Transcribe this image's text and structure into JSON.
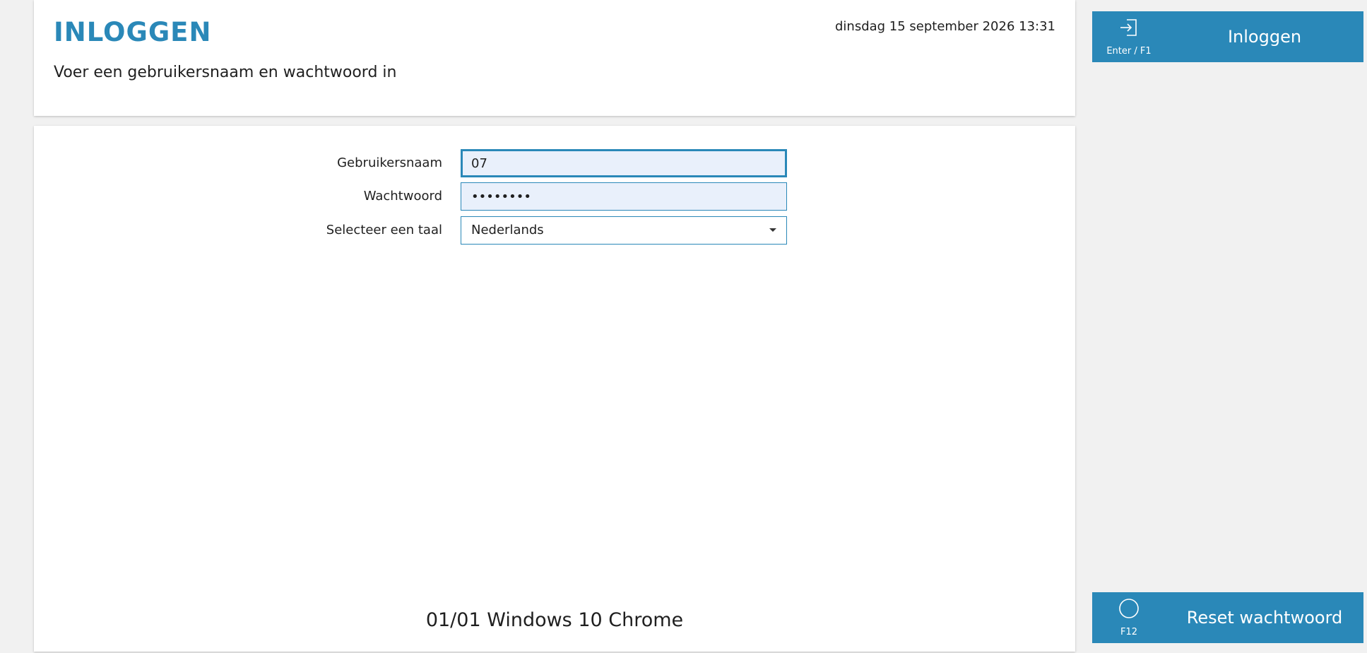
{
  "header": {
    "title": "INLOGGEN",
    "subtitle": "Voer een gebruikersnaam en wachtwoord in",
    "datetime": "dinsdag 15 september 2026 13:31"
  },
  "form": {
    "username": {
      "label": "Gebruikersnaam",
      "value": "07"
    },
    "password": {
      "label": "Wachtwoord",
      "value": "••••••••"
    },
    "language": {
      "label": "Selecteer een taal",
      "selected": "Nederlands"
    }
  },
  "footer": {
    "version": "01/01 Windows 10 Chrome"
  },
  "actions": {
    "login": {
      "label": "Inloggen",
      "shortcut": "Enter / F1",
      "icon": "login-icon"
    },
    "reset": {
      "label": "Reset wachtwoord",
      "shortcut": "F12",
      "icon": "circle-icon"
    }
  },
  "colors": {
    "accent": "#2a88b8",
    "input_bg": "#e9f0fb",
    "page_bg": "#f1f1f1"
  }
}
